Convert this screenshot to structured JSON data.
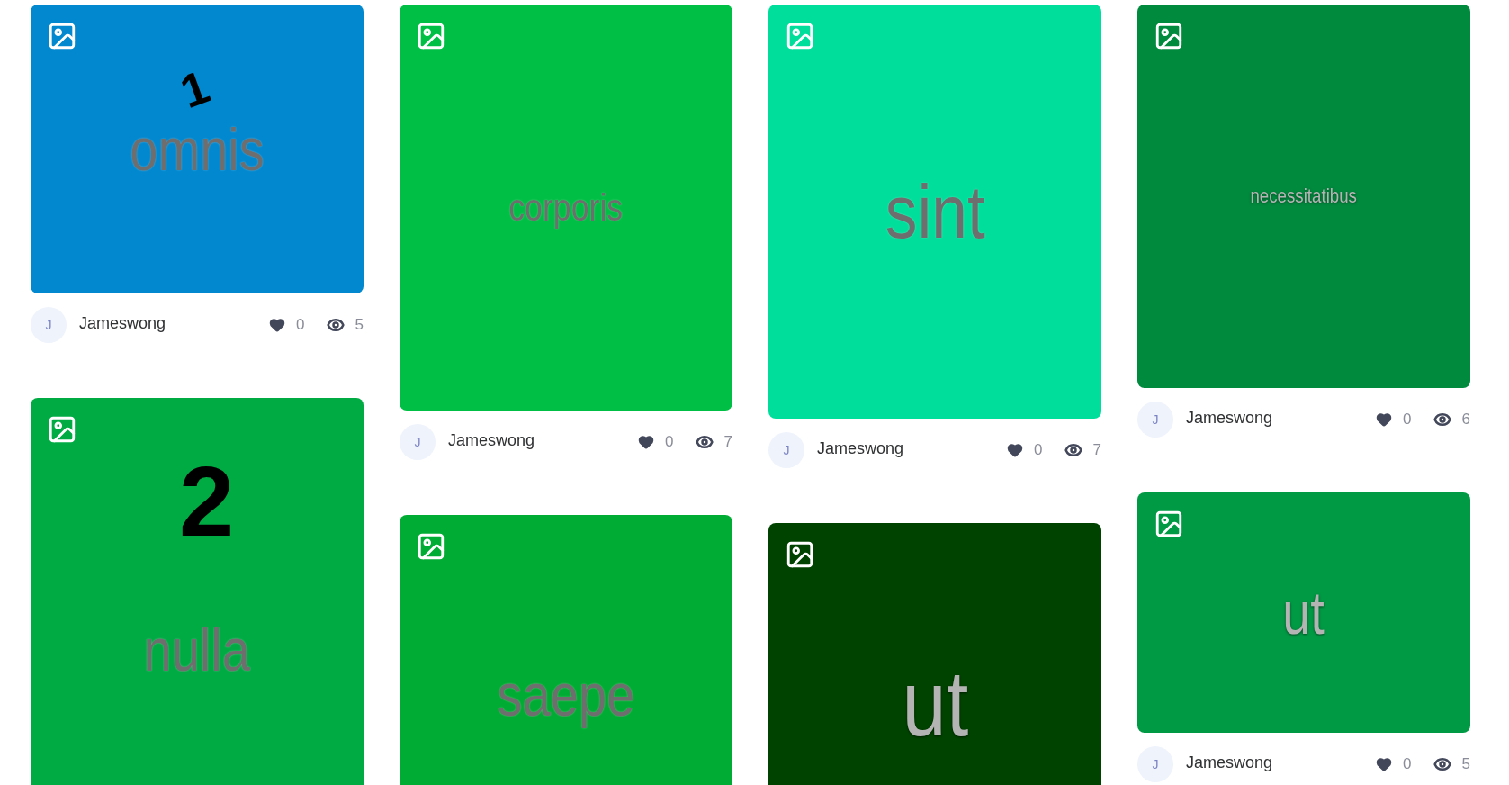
{
  "columns": [
    {
      "cards": [
        {
          "image_text": "omnis",
          "color": "#0288cf",
          "mark": "1",
          "author": "Jameswong",
          "avatar": "J",
          "likes": "0",
          "views": "5"
        },
        {
          "image_text": "nulla",
          "color": "#00ab44",
          "mark": "2"
        }
      ]
    },
    {
      "cards": [
        {
          "image_text": "corporis",
          "color": "#00bf45",
          "author": "Jameswong",
          "avatar": "J",
          "likes": "0",
          "views": "7"
        },
        {
          "image_text": "saepe",
          "color": "#00ac33"
        }
      ]
    },
    {
      "cards": [
        {
          "image_text": "sint",
          "color": "#00de9b",
          "author": "Jameswong",
          "avatar": "J",
          "likes": "0",
          "views": "7"
        },
        {
          "image_text": "ut",
          "color": "#004300"
        }
      ]
    },
    {
      "cards": [
        {
          "image_text": "necessitatibus",
          "color": "#008a3e",
          "author": "Jameswong",
          "avatar": "J",
          "likes": "0",
          "views": "6"
        },
        {
          "image_text": "ut",
          "color": "#009a44",
          "author": "Jameswong",
          "avatar": "J",
          "likes": "0",
          "views": "5"
        }
      ]
    }
  ]
}
